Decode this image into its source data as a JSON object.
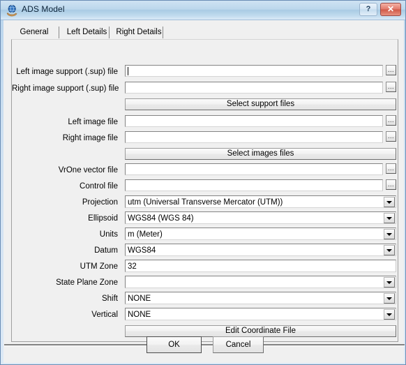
{
  "window": {
    "title": "ADS Model",
    "icon": "globe-hand-icon",
    "help_label": "?",
    "close_label": "✕",
    "accent_title_bar": "#b9d4ec",
    "close_button_color": "#d05948"
  },
  "tabs": [
    {
      "label": "General",
      "selected": true
    },
    {
      "label": "Left Details",
      "selected": false
    },
    {
      "label": "Right Details",
      "selected": false
    }
  ],
  "form": {
    "browse_label": "...",
    "fields": [
      {
        "name": "left-image-support-file",
        "label": "Left image support (.sup) file",
        "type": "text",
        "value": "",
        "focused": true
      },
      {
        "name": "right-image-support-file",
        "label": "Right image support (.sup) file",
        "type": "text",
        "value": "",
        "focused": false
      },
      {
        "name": "left-image-file",
        "label": "Left image file",
        "type": "text",
        "value": "",
        "focused": false
      },
      {
        "name": "right-image-file",
        "label": "Right image file",
        "type": "text",
        "value": "",
        "focused": false
      },
      {
        "name": "vrone-vector-file",
        "label": "VrOne vector file",
        "type": "text",
        "value": "",
        "focused": false
      },
      {
        "name": "control-file",
        "label": "Control file",
        "type": "text",
        "value": "",
        "focused": false
      },
      {
        "name": "projection",
        "label": "Projection",
        "type": "combo",
        "value": "utm (Universal Transverse Mercator (UTM))"
      },
      {
        "name": "ellipsoid",
        "label": "Ellipsoid",
        "type": "combo",
        "value": "WGS84 (WGS 84)"
      },
      {
        "name": "units",
        "label": "Units",
        "type": "combo",
        "value": "m (Meter)"
      },
      {
        "name": "datum",
        "label": "Datum",
        "type": "combo",
        "value": "WGS84"
      },
      {
        "name": "utm-zone",
        "label": "UTM Zone",
        "type": "plain",
        "value": "32"
      },
      {
        "name": "state-plane-zone",
        "label": "State Plane Zone",
        "type": "combo",
        "value": ""
      },
      {
        "name": "shift",
        "label": "Shift",
        "type": "combo",
        "value": "NONE"
      },
      {
        "name": "vertical",
        "label": "Vertical",
        "type": "combo",
        "value": "NONE"
      }
    ],
    "action_buttons": {
      "select_support_files": "Select support files",
      "select_images_files": "Select images files",
      "edit_coordinate_file": "Edit Coordinate File"
    }
  },
  "footer": {
    "ok_label": "OK",
    "cancel_label": "Cancel"
  }
}
